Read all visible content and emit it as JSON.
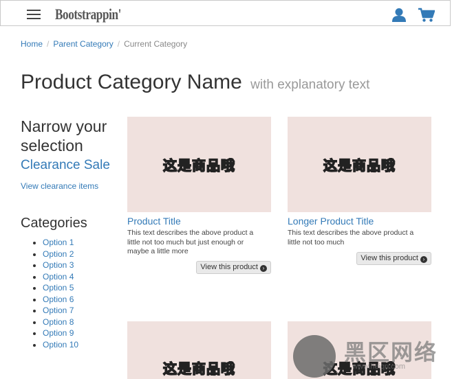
{
  "header": {
    "brand": "Bootstrappin'"
  },
  "breadcrumb": {
    "home": "Home",
    "parent": "Parent Category",
    "current": "Current Category",
    "separator": "/"
  },
  "page": {
    "title": "Product Category Name",
    "subtitle": "with explanatory text"
  },
  "sidebar": {
    "narrow_heading": "Narrow your selection",
    "clearance_title": "Clearance Sale",
    "clearance_link": "View clearance items",
    "categories_heading": "Categories",
    "categories": [
      "Option 1",
      "Option 2",
      "Option 3",
      "Option 4",
      "Option 5",
      "Option 6",
      "Option 7",
      "Option 8",
      "Option 9",
      "Option 10"
    ]
  },
  "products": [
    {
      "image_text": "这是商品哦",
      "title": "Product Title",
      "description": "This text describes the above product a little not too much but just enough or maybe a little more",
      "button": "View this product"
    },
    {
      "image_text": "这是商品哦",
      "title": "Longer Product Title",
      "description": "This text describes the above product a little not too much",
      "button": "View this product"
    },
    {
      "image_text": "这是商品哦"
    },
    {
      "image_text": "这是商品哦"
    }
  ],
  "watermark": {
    "text": "黑区网络",
    "url": "www.heiqu.com"
  },
  "colors": {
    "link": "#337ab7",
    "image_bg": "#f0e1de",
    "text": "#333333"
  },
  "icons": [
    "menu-icon",
    "user-icon",
    "cart-icon",
    "chevron-circle-right-icon"
  ]
}
